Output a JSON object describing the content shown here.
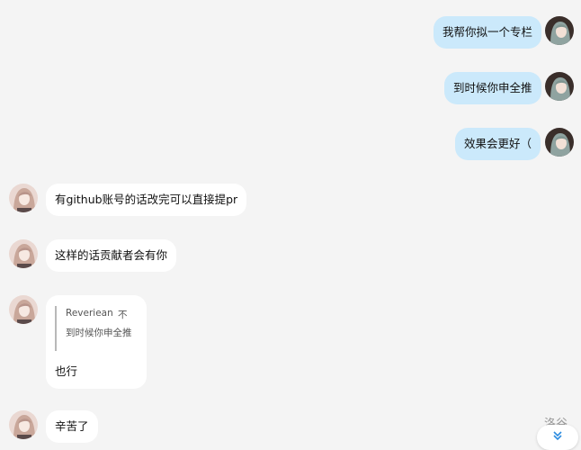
{
  "messages": [
    {
      "side": "right",
      "text": "我帮你拟一个专栏"
    },
    {
      "side": "right",
      "text": "到时候你申全推"
    },
    {
      "side": "right",
      "text": "效果会更好（"
    },
    {
      "side": "left",
      "text": "有github账号的话改完可以直接提pr"
    },
    {
      "side": "left",
      "text": "这样的话贡献者会有你"
    },
    {
      "side": "left",
      "quote": {
        "author": "Reveriean",
        "tag": "不",
        "text": "到时候你申全推"
      },
      "text": "也行"
    },
    {
      "side": "left",
      "text": "辛苦了"
    }
  ],
  "brand": "洛谷",
  "icons": {
    "scroll_down": "double-chevron-down-icon"
  },
  "colors": {
    "background": "#f4f4f4",
    "self_bubble": "#cbe9fb",
    "other_bubble": "#ffffff",
    "accent": "#2d8ce0"
  }
}
